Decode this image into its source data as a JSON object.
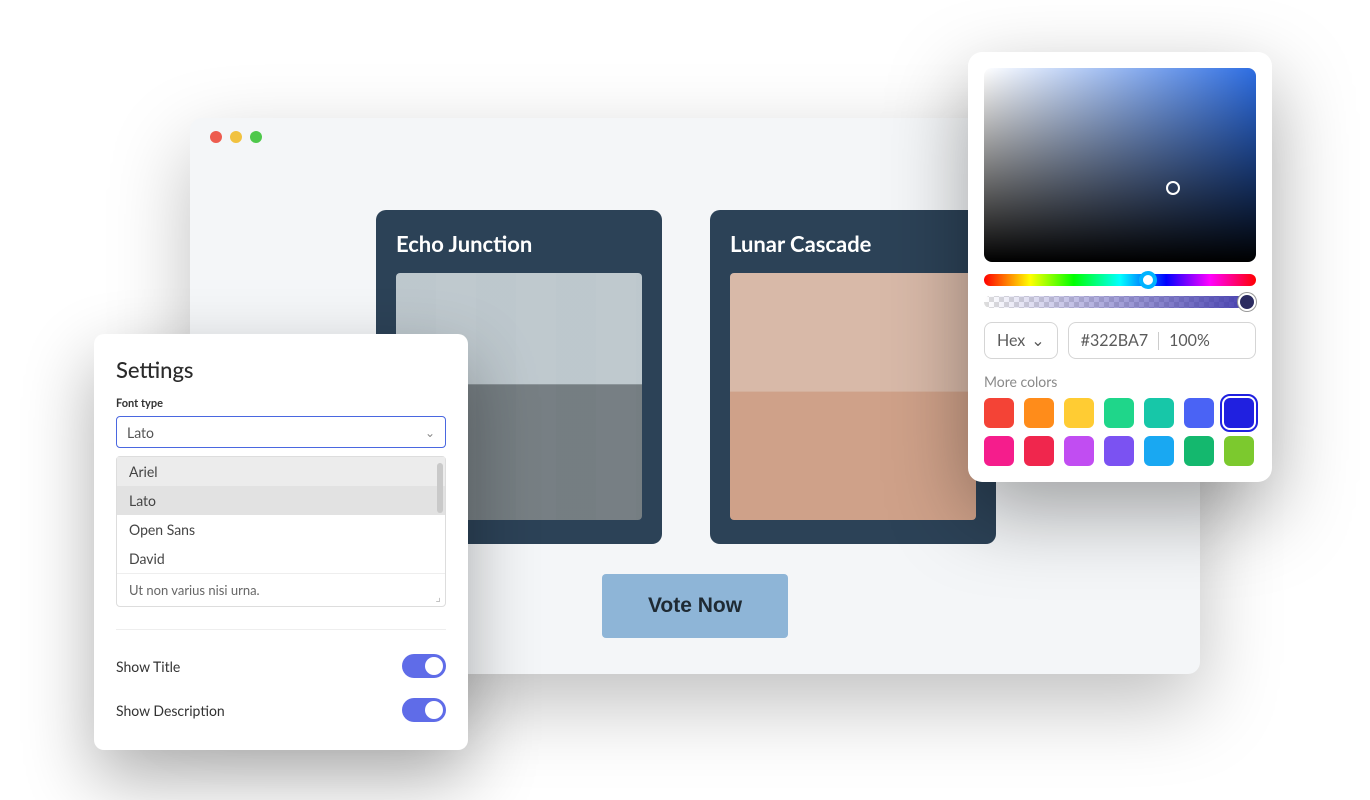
{
  "browser": {
    "cards": [
      {
        "title": "Echo Junction"
      },
      {
        "title": "Lunar Cascade"
      }
    ],
    "vote_label": "Vote Now"
  },
  "settings": {
    "title": "Settings",
    "font_type_label": "Font type",
    "selected_font": "Lato",
    "font_options": [
      "Ariel",
      "Lato",
      "Open Sans",
      "David"
    ],
    "textarea_value": "Ut non varius nisi urna.",
    "show_title_label": "Show Title",
    "show_title_on": true,
    "show_description_label": "Show Description",
    "show_description_on": true
  },
  "color_picker": {
    "format_label": "Hex",
    "hex_value": "#322BA7",
    "opacity_value": "100%",
    "more_colors_label": "More colors",
    "swatches": [
      {
        "hex": "#f44336",
        "selected": false
      },
      {
        "hex": "#ff8c1a",
        "selected": false
      },
      {
        "hex": "#ffcc33",
        "selected": false
      },
      {
        "hex": "#1fd68a",
        "selected": false
      },
      {
        "hex": "#17c7a8",
        "selected": false
      },
      {
        "hex": "#4a63f5",
        "selected": false
      },
      {
        "hex": "#2020e0",
        "selected": true
      },
      {
        "hex": "#f51d8c",
        "selected": false
      },
      {
        "hex": "#f0264d",
        "selected": false
      },
      {
        "hex": "#c14df2",
        "selected": false
      },
      {
        "hex": "#7b52f2",
        "selected": false
      },
      {
        "hex": "#19a8f2",
        "selected": false
      },
      {
        "hex": "#14b86e",
        "selected": false
      },
      {
        "hex": "#7cc92e",
        "selected": false
      }
    ]
  }
}
